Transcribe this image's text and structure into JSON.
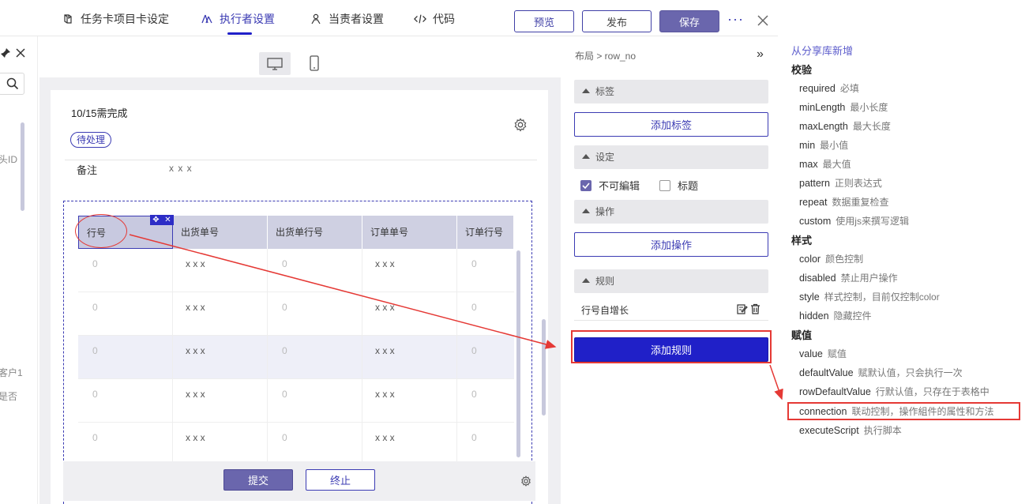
{
  "topbar": {
    "tabs": [
      {
        "label": "任务卡项目卡设定",
        "icon": "cube-icon",
        "active": false
      },
      {
        "label": "执行者设置",
        "icon": "users-icon",
        "active": true
      },
      {
        "label": "当责者设置",
        "icon": "user-icon",
        "active": false
      },
      {
        "label": "代码",
        "icon": "code-icon",
        "active": false
      }
    ],
    "preview_label": "预览",
    "publish_label": "发布",
    "save_label": "保存",
    "more_label": "···",
    "accent": "#3b3bb3"
  },
  "left_panel": {
    "text_id": "头ID",
    "text_user": "客户1",
    "text_whether": "是否"
  },
  "canvas": {
    "progress": "10/15需完成",
    "status_badge": "待处理",
    "remark_label": "备注",
    "remark_value": "x x x",
    "table": {
      "columns": [
        "行号",
        "出货单号",
        "出货单行号",
        "订单单号",
        "订单行号"
      ],
      "rows": [
        [
          "0",
          "x x x",
          "0",
          "x x x",
          "0"
        ],
        [
          "0",
          "x x x",
          "0",
          "x x x",
          "0"
        ],
        [
          "0",
          "x x x",
          "0",
          "x x x",
          "0"
        ],
        [
          "0",
          "x x x",
          "0",
          "x x x",
          "0"
        ],
        [
          "0",
          "x x x",
          "0",
          "x x x",
          "0"
        ]
      ],
      "highlighted_row": 2
    },
    "submit_label": "提交",
    "stop_label": "终止"
  },
  "properties": {
    "breadcrumb": "布局 > row_no",
    "collapse_icon": "»",
    "sections": {
      "label": "标签",
      "setting": "设定",
      "action": "操作",
      "rule": "规则"
    },
    "add_label": "添加标签",
    "add_action": "添加操作",
    "add_rule": "添加规则",
    "readonly_label": "不可編辑",
    "readonly_checked": true,
    "title_label": "标题",
    "title_checked": false,
    "rule_item": "行号自增长"
  },
  "docs": {
    "link": "从分享库新增",
    "groups": [
      {
        "heading": "校验",
        "items": [
          {
            "name": "required",
            "desc": "必填"
          },
          {
            "name": "minLength",
            "desc": "最小长度"
          },
          {
            "name": "maxLength",
            "desc": "最大长度"
          },
          {
            "name": "min",
            "desc": "最小值"
          },
          {
            "name": "max",
            "desc": "最大值"
          },
          {
            "name": "pattern",
            "desc": "正则表达式"
          },
          {
            "name": "repeat",
            "desc": "数据重复检查"
          },
          {
            "name": "custom",
            "desc": "使用js来撰写逻辑"
          }
        ]
      },
      {
        "heading": "样式",
        "items": [
          {
            "name": "color",
            "desc": "颜色控制"
          },
          {
            "name": "disabled",
            "desc": "禁止用户操作"
          },
          {
            "name": "style",
            "desc": "样式控制，目前仅控制color"
          },
          {
            "name": "hidden",
            "desc": "隐藏控件"
          }
        ]
      },
      {
        "heading": "赋值",
        "items": [
          {
            "name": "value",
            "desc": "赋值"
          },
          {
            "name": "defaultValue",
            "desc": "赋默认值，只会执行一次"
          },
          {
            "name": "rowDefaultValue",
            "desc": "行默认值，只存在于表格中"
          },
          {
            "name": "connection",
            "desc": "联动控制，操作組件的属性和方法"
          },
          {
            "name": "executeScript",
            "desc": "执行脚本"
          }
        ]
      }
    ]
  },
  "annotation_color": "#e53935"
}
